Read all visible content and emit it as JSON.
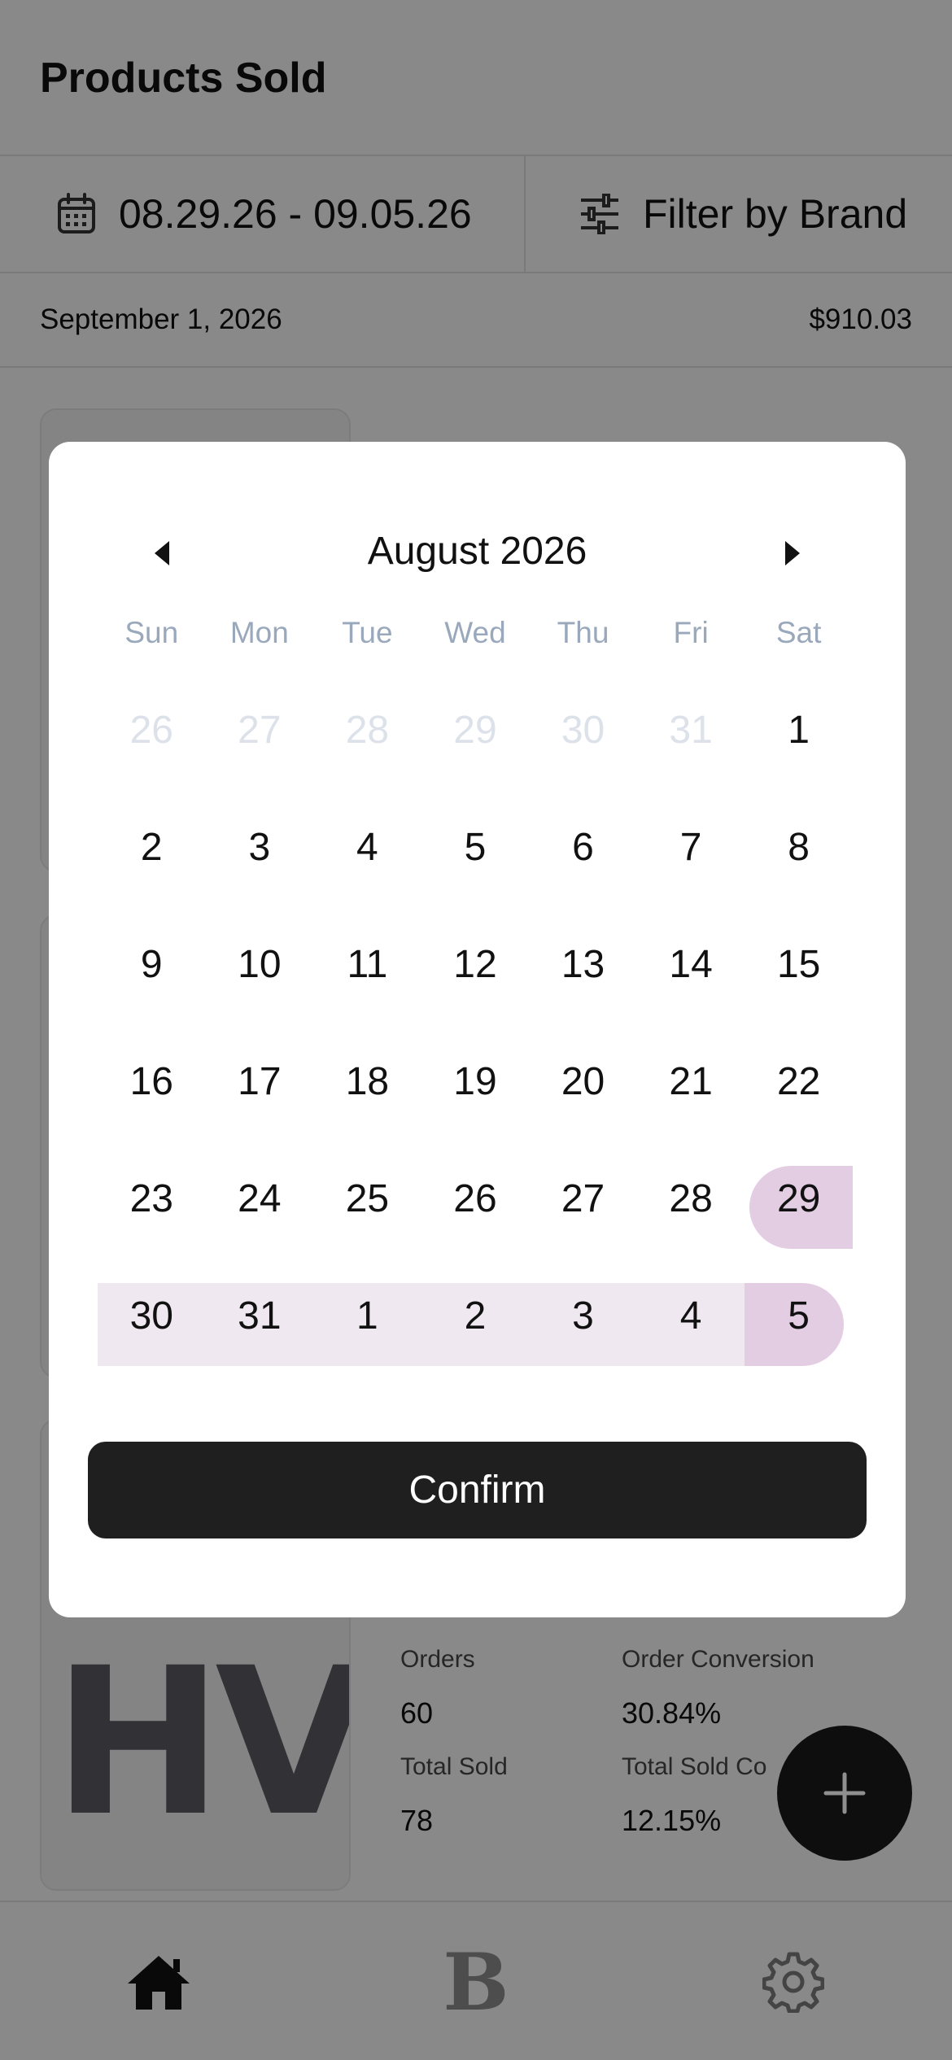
{
  "header": {
    "title": "Products Sold"
  },
  "toolbar": {
    "date_range": "08.29.26 - 09.05.26",
    "date_icon": "calendar-icon",
    "brand_filter": "Filter by Brand",
    "brand_icon": "sliders-icon"
  },
  "summary": {
    "date": "September 1, 2026",
    "amount": "$910.03"
  },
  "product_card": {
    "logo_text": "HV",
    "stats": [
      {
        "label": "Orders",
        "value": "60"
      },
      {
        "label": "Order Conversion",
        "value": "30.84%"
      },
      {
        "label": "Total Sold",
        "value": "78"
      },
      {
        "label": "Total Sold Co",
        "value": "12.15%"
      }
    ]
  },
  "fab": {
    "icon": "plus-icon"
  },
  "tabbar": {
    "tabs": [
      {
        "name": "home",
        "icon": "home-icon"
      },
      {
        "name": "brands",
        "icon": "brand-b-icon",
        "glyph": "B"
      },
      {
        "name": "settings",
        "icon": "gear-icon"
      }
    ]
  },
  "calendar": {
    "month_label": "August 2026",
    "prev_icon": "triangle-left-icon",
    "next_icon": "triangle-right-icon",
    "weekdays": [
      "Sun",
      "Mon",
      "Tue",
      "Wed",
      "Thu",
      "Fri",
      "Sat"
    ],
    "weeks": [
      [
        "26",
        "27",
        "28",
        "29",
        "30",
        "31",
        "1"
      ],
      [
        "2",
        "3",
        "4",
        "5",
        "6",
        "7",
        "8"
      ],
      [
        "9",
        "10",
        "11",
        "12",
        "13",
        "14",
        "15"
      ],
      [
        "16",
        "17",
        "18",
        "19",
        "20",
        "21",
        "22"
      ],
      [
        "23",
        "24",
        "25",
        "26",
        "27",
        "28",
        "29"
      ],
      [
        "30",
        "31",
        "1",
        "2",
        "3",
        "4",
        "5"
      ]
    ],
    "range_start": "29",
    "range_end": "5",
    "confirm_label": "Confirm",
    "colors": {
      "range_fill": "#f0e8f0",
      "range_endpoint": "#e2cde2",
      "muted_day": "#dde2ea",
      "weekday": "#9aa8bc"
    }
  }
}
